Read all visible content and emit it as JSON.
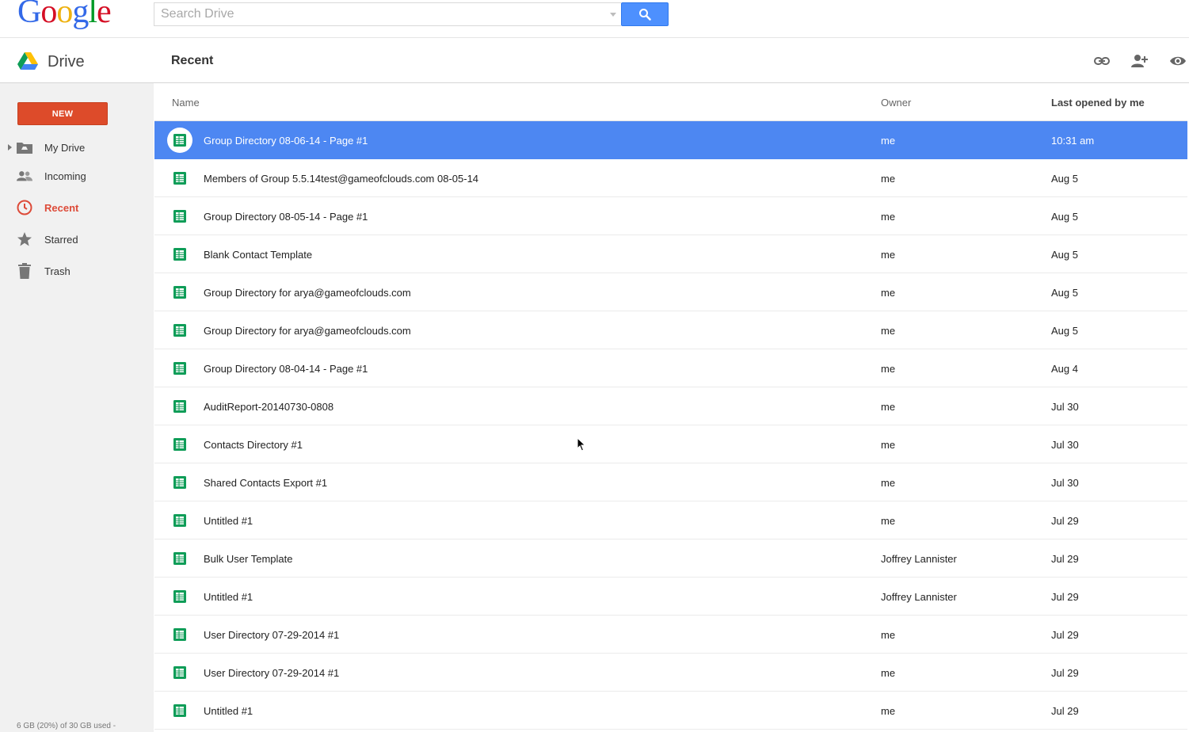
{
  "header": {
    "logo_text": "Google",
    "logo_colors": [
      "#3369e8",
      "#d50f25",
      "#eeb211",
      "#3369e8",
      "#009925",
      "#d50f25"
    ],
    "search_placeholder": "Search Drive"
  },
  "subheader": {
    "app_name": "Drive",
    "page_title": "Recent",
    "toolbar_icons": [
      "link-icon",
      "share-person-icon",
      "preview-eye-icon"
    ]
  },
  "sidebar": {
    "new_label": "NEW",
    "items": [
      {
        "label": "My Drive",
        "icon": "my-drive-icon",
        "active": false
      },
      {
        "label": "Incoming",
        "icon": "incoming-people-icon",
        "active": false
      },
      {
        "label": "Recent",
        "icon": "clock-icon",
        "active": true
      },
      {
        "label": "Starred",
        "icon": "star-icon",
        "active": false
      },
      {
        "label": "Trash",
        "icon": "trash-icon",
        "active": false
      }
    ],
    "quota": "6 GB (20%) of 30 GB used -"
  },
  "table": {
    "headers": {
      "name": "Name",
      "owner": "Owner",
      "last_opened": "Last opened by me"
    },
    "rows": [
      {
        "name": "Group Directory 08-06-14 - Page #1",
        "owner": "me",
        "date": "10:31 am",
        "selected": true
      },
      {
        "name": "Members of Group 5.5.14test@gameofclouds.com 08-05-14",
        "owner": "me",
        "date": "Aug 5"
      },
      {
        "name": "Group Directory 08-05-14 - Page #1",
        "owner": "me",
        "date": "Aug 5"
      },
      {
        "name": "Blank Contact Template",
        "owner": "me",
        "date": "Aug 5"
      },
      {
        "name": "Group Directory for arya@gameofclouds.com",
        "owner": "me",
        "date": "Aug 5"
      },
      {
        "name": "Group Directory for arya@gameofclouds.com",
        "owner": "me",
        "date": "Aug 5"
      },
      {
        "name": "Group Directory 08-04-14 - Page #1",
        "owner": "me",
        "date": "Aug 4"
      },
      {
        "name": "AuditReport-20140730-0808",
        "owner": "me",
        "date": "Jul 30"
      },
      {
        "name": "Contacts Directory #1",
        "owner": "me",
        "date": "Jul 30"
      },
      {
        "name": "Shared Contacts Export #1",
        "owner": "me",
        "date": "Jul 30"
      },
      {
        "name": "Untitled #1",
        "owner": "me",
        "date": "Jul 29"
      },
      {
        "name": "Bulk User Template",
        "owner": "Joffrey Lannister",
        "date": "Jul 29"
      },
      {
        "name": "Untitled #1",
        "owner": "Joffrey Lannister",
        "date": "Jul 29"
      },
      {
        "name": "User Directory 07-29-2014 #1",
        "owner": "me",
        "date": "Jul 29"
      },
      {
        "name": "User Directory 07-29-2014 #1",
        "owner": "me",
        "date": "Jul 29"
      },
      {
        "name": "Untitled #1",
        "owner": "me",
        "date": "Jul 29"
      }
    ]
  },
  "colors": {
    "accent_blue": "#4d90fe",
    "selected_row": "#4d87f2",
    "new_button": "#dd4b2a",
    "active_nav": "#dd4b39",
    "sheet_icon": "#0f9d58"
  }
}
